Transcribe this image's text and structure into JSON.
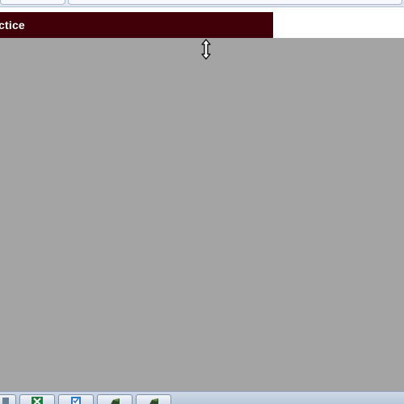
{
  "header": {
    "title": "ctice",
    "background_color": "#3e0006"
  },
  "content": {
    "background_color": "#a4a4a4"
  },
  "cursor": {
    "icon": "vertical-resize-cursor-icon"
  },
  "taskbar": {
    "buttons": [
      {
        "icon": "app-icon"
      },
      {
        "icon": "excel-icon"
      },
      {
        "icon": "checkbox-app-icon"
      },
      {
        "icon": "green-app-icon"
      },
      {
        "icon": "green-app-icon"
      }
    ]
  }
}
